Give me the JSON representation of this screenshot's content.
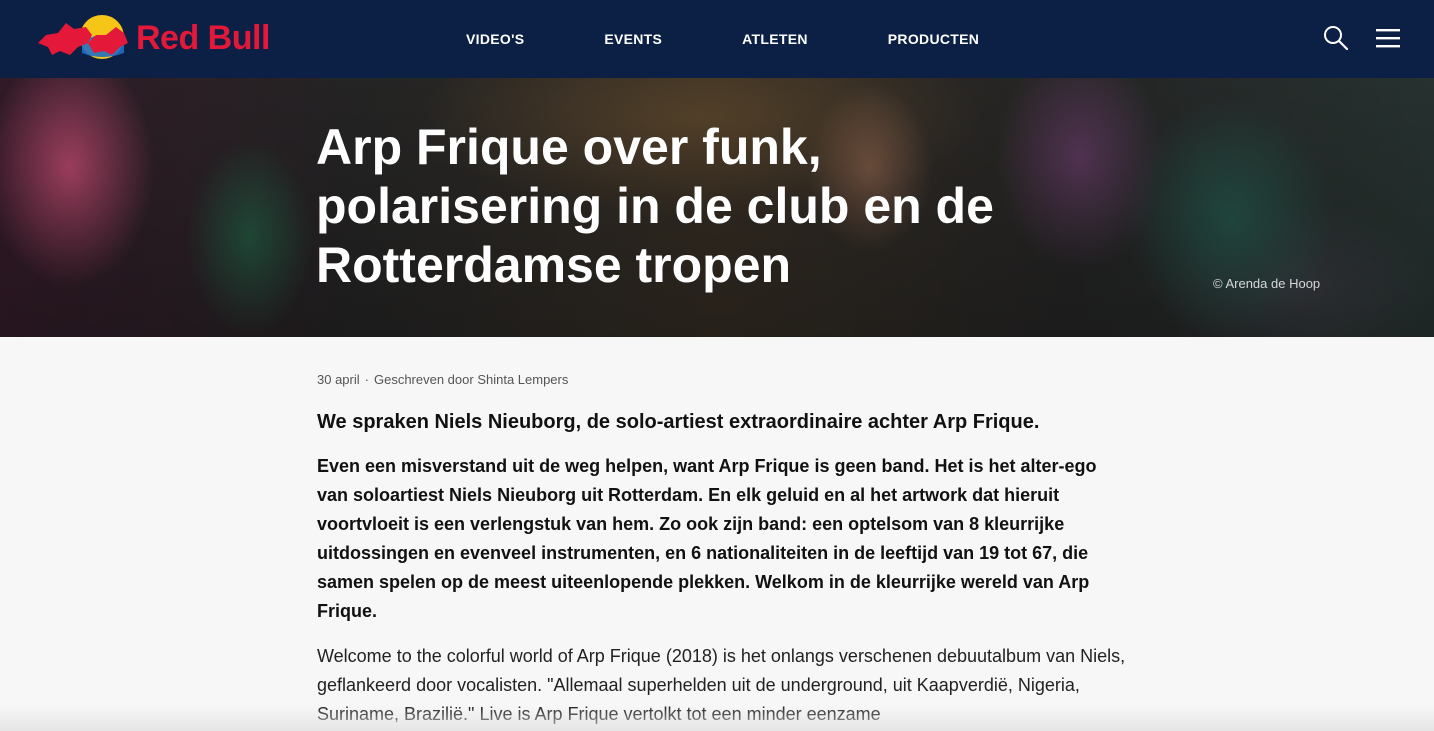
{
  "brand": {
    "name": "Red Bull",
    "red": "#e4193a",
    "navy": "#0b2044",
    "yellow": "#f5c518"
  },
  "nav": {
    "items": [
      "VIDEO'S",
      "EVENTS",
      "ATLETEN",
      "PRODUCTEN"
    ]
  },
  "header": {
    "search_icon": "search-icon",
    "menu_icon": "hamburger-menu-icon"
  },
  "hero": {
    "title": "Arp Frique over funk, polarisering in de club en de Rotterdamse tropen",
    "credit": "© Arenda de Hoop"
  },
  "article": {
    "date": "30 april",
    "separator": "·",
    "author": "Geschreven door Shinta Lempers",
    "lead": "We spraken Niels Nieuborg, de solo-artiest extraordinaire achter Arp Frique.",
    "intro": "Even een misverstand uit de weg helpen, want Arp Frique is geen band. Het is het alter-ego van soloartiest Niels Nieuborg uit Rotterdam. En elk geluid en al het artwork dat hieruit voortvloeit is een verlengstuk van hem. Zo ook zijn band: een optelsom van 8 kleurrijke uitdossingen en evenveel instrumenten, en 6 nationaliteiten in de leeftijd van 19 tot 67, die samen spelen op de meest uiteenlopende plekken. Welkom in de kleurrijke wereld van Arp Frique.",
    "body": "Welcome to the colorful world of Arp Frique (2018) is het onlangs verschenen debuutalbum van Niels, geflankeerd door vocalisten. \"Allemaal superhelden uit de underground, uit Kaapverdië, Nigeria, Suriname, Brazilië.\" Live is Arp Frique vertolkt tot een minder eenzame"
  }
}
